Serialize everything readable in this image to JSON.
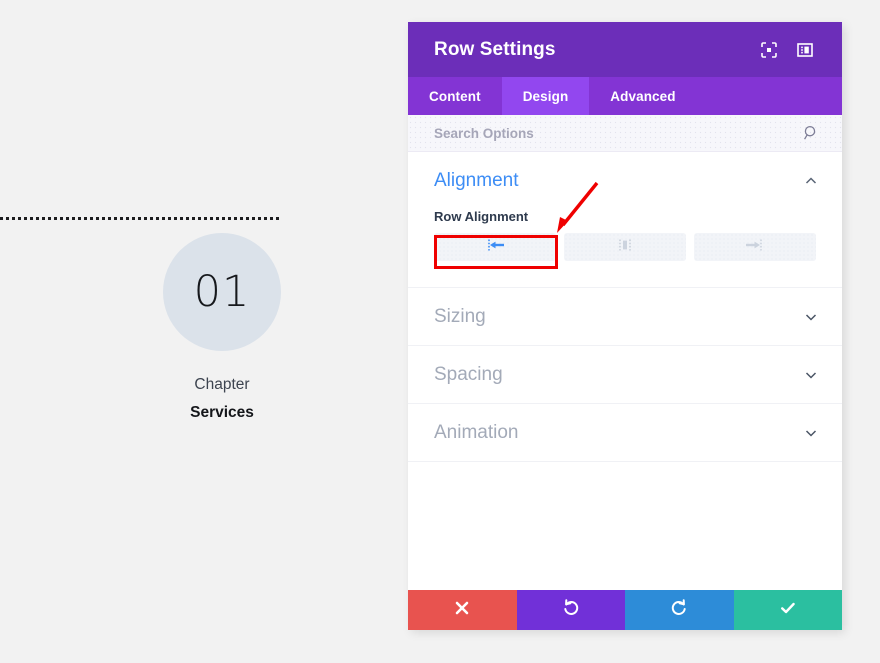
{
  "canvas": {
    "chapter": {
      "number": "01",
      "label": "Chapter",
      "title": "Services"
    },
    "divider_icon": "dotted-divider"
  },
  "panel": {
    "title": "Row Settings",
    "header_icons": [
      {
        "name": "expand-focus-icon",
        "glyph": "focus"
      },
      {
        "name": "layout-panel-icon",
        "glyph": "panel"
      }
    ],
    "tabs": [
      {
        "label": "Content",
        "active": false
      },
      {
        "label": "Design",
        "active": true
      },
      {
        "label": "Advanced",
        "active": false
      }
    ],
    "search": {
      "placeholder": "Search Options",
      "value": "",
      "icon": "search-icon"
    },
    "sections": [
      {
        "title": "Alignment",
        "open": true,
        "chevron": "chevron-up-icon",
        "field_label": "Row Alignment",
        "options": [
          {
            "name": "align-left",
            "icon": "arrow-left-align-icon",
            "selected": true
          },
          {
            "name": "align-center",
            "icon": "align-center-icon",
            "selected": false
          },
          {
            "name": "align-right",
            "icon": "arrow-right-align-icon",
            "selected": false
          }
        ]
      },
      {
        "title": "Sizing",
        "open": false,
        "chevron": "chevron-down-icon"
      },
      {
        "title": "Spacing",
        "open": false,
        "chevron": "chevron-down-icon"
      },
      {
        "title": "Animation",
        "open": false,
        "chevron": "chevron-down-icon"
      }
    ],
    "footer": [
      {
        "name": "cancel-button",
        "icon": "close-x-icon",
        "color": "#e8534f"
      },
      {
        "name": "undo-button",
        "icon": "undo-arrow-icon",
        "color": "#7130d8"
      },
      {
        "name": "redo-button",
        "icon": "redo-arrow-icon",
        "color": "#2d8cd8"
      },
      {
        "name": "save-button",
        "icon": "checkmark-icon",
        "color": "#2bbfa0"
      }
    ]
  },
  "annotations": {
    "highlight_color": "#ef0000",
    "arrow_color": "#ef0000",
    "highlight_target": "align-left-button",
    "arrow_target": "align-left-button"
  },
  "colors": {
    "header_purple": "#6c2eb9",
    "tabs_purple": "#8334d4",
    "active_tab_purple": "#9247ef",
    "section_open_blue": "#3d8df5",
    "section_closed_gray": "#a3aab8",
    "circle_bg": "#dbe2ea",
    "page_bg": "#f2f2f2"
  }
}
